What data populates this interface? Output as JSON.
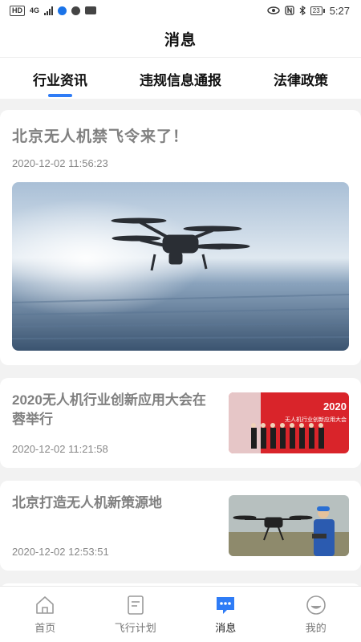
{
  "status_bar": {
    "left_chips": [
      "HD",
      "4G"
    ],
    "battery": "23",
    "time": "5:27"
  },
  "header": {
    "title": "消息"
  },
  "tabs": [
    {
      "label": "行业资讯",
      "active": true
    },
    {
      "label": "违规信息通报",
      "active": false
    },
    {
      "label": "法律政策",
      "active": false
    }
  ],
  "news": {
    "featured": {
      "title": "北京无人机禁飞令来了！",
      "time": "2020-12-02 11:56:23",
      "image_icon": "drone-over-city-image"
    },
    "items": [
      {
        "title": "2020无人机行业创新应用大会在蓉举行",
        "time": "2020-12-02 11:21:58",
        "thumb_icon": "conference-photo",
        "thumb_text": "2020",
        "thumb_caption": "无人机行业创新应用大会"
      },
      {
        "title": "北京打造无人机新策源地",
        "time": "2020-12-02 12:53:51",
        "thumb_icon": "pilot-with-drone-photo"
      }
    ]
  },
  "bottom_nav": [
    {
      "label": "首页",
      "icon": "home-icon",
      "active": false
    },
    {
      "label": "飞行计划",
      "icon": "document-icon",
      "active": false
    },
    {
      "label": "消息",
      "icon": "message-icon",
      "active": true
    },
    {
      "label": "我的",
      "icon": "profile-icon",
      "active": false
    }
  ],
  "colors": {
    "accent": "#2f7cf6",
    "feed_background": "#f2f2f2",
    "title_gray": "#808080"
  }
}
